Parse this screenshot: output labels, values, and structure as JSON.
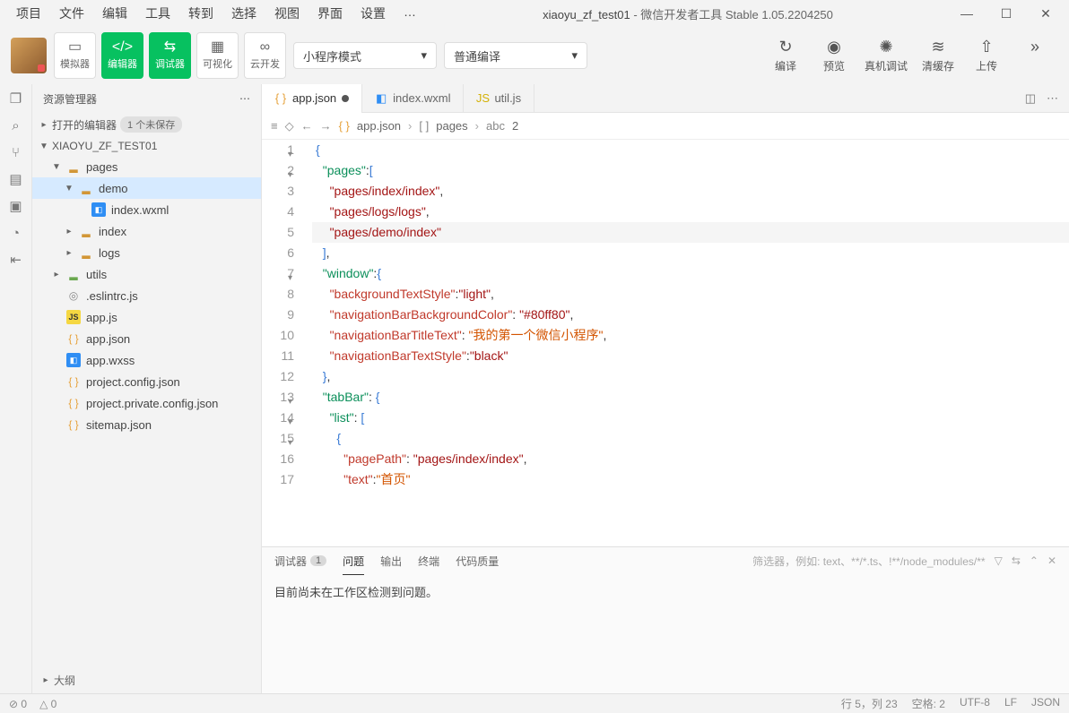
{
  "menu": {
    "items": [
      "项目",
      "文件",
      "编辑",
      "工具",
      "转到",
      "选择",
      "视图",
      "界面",
      "设置",
      "…"
    ]
  },
  "window": {
    "project": "xiaoyu_zf_test01",
    "suffix": " - 微信开发者工具 Stable 1.05.2204250"
  },
  "toolbar": {
    "simulator": "模拟器",
    "editor": "编辑器",
    "debugger": "调试器",
    "visual": "可视化",
    "cloud": "云开发",
    "modeSelect": "小程序模式",
    "compileSelect": "普通编译",
    "compile": "编译",
    "preview": "预览",
    "remote": "真机调试",
    "clear": "清缓存",
    "upload": "上传"
  },
  "sidebar": {
    "title": "资源管理器",
    "open_editors": "打开的编辑器",
    "unsaved_badge": "1 个未保存",
    "project": "XIAOYU_ZF_TEST01",
    "tree": [
      {
        "ind": 1,
        "chev": "▼",
        "icon": "folder-o",
        "label": "pages"
      },
      {
        "ind": 2,
        "chev": "▼",
        "icon": "folder-o",
        "label": "demo",
        "sel": true
      },
      {
        "ind": 3,
        "chev": "",
        "icon": "wxml",
        "label": "index.wxml"
      },
      {
        "ind": 2,
        "chev": "▸",
        "icon": "folder",
        "label": "index"
      },
      {
        "ind": 2,
        "chev": "▸",
        "icon": "folder",
        "label": "logs"
      },
      {
        "ind": 1,
        "chev": "▸",
        "icon": "folder-g",
        "label": "utils"
      },
      {
        "ind": 1,
        "chev": "",
        "icon": "cfg",
        "label": ".eslintrc.js"
      },
      {
        "ind": 1,
        "chev": "",
        "icon": "js",
        "label": "app.js"
      },
      {
        "ind": 1,
        "chev": "",
        "icon": "json",
        "label": "app.json"
      },
      {
        "ind": 1,
        "chev": "",
        "icon": "wxss",
        "label": "app.wxss"
      },
      {
        "ind": 1,
        "chev": "",
        "icon": "json",
        "label": "project.config.json"
      },
      {
        "ind": 1,
        "chev": "",
        "icon": "json",
        "label": "project.private.config.json"
      },
      {
        "ind": 1,
        "chev": "",
        "icon": "json",
        "label": "sitemap.json"
      }
    ],
    "outline": "大纲"
  },
  "tabs": [
    {
      "icon": "json",
      "label": "app.json",
      "active": true,
      "dirty": true
    },
    {
      "icon": "wxml",
      "label": "index.wxml"
    },
    {
      "icon": "js",
      "label": "util.js"
    }
  ],
  "breadcrumb": {
    "file": "app.json",
    "seg1": "pages",
    "seg2": "2"
  },
  "code": {
    "lines": [
      {
        "n": 1,
        "fold": "▾",
        "html": "<span class='tk-br'>{</span>"
      },
      {
        "n": 2,
        "fold": "▾",
        "html": "  <span class='tk-key'>\"pages\"</span>:<span class='tk-br'>[</span>"
      },
      {
        "n": 3,
        "html": "    <span class='tk-str'>\"pages/index/index\"</span>,"
      },
      {
        "n": 4,
        "html": "    <span class='tk-str'>\"pages/logs/logs\"</span>,"
      },
      {
        "n": 5,
        "cur": true,
        "html": "    <span class='tk-str'>\"pages/demo/index\"</span>"
      },
      {
        "n": 6,
        "html": "  <span class='tk-br'>]</span>,"
      },
      {
        "n": 7,
        "fold": "▾",
        "html": "  <span class='tk-key'>\"window\"</span>:<span class='tk-br'>{</span>"
      },
      {
        "n": 8,
        "html": "    <span class='tk-prop'>\"backgroundTextStyle\"</span>:<span class='tk-str'>\"light\"</span>,"
      },
      {
        "n": 9,
        "html": "    <span class='tk-prop'>\"navigationBarBackgroundColor\"</span>: <span class='tk-str'>\"#80ff80\"</span>,"
      },
      {
        "n": 10,
        "html": "    <span class='tk-prop'>\"navigationBarTitleText\"</span>: <span class='tk-cn'>\"我的第一个微信小程序\"</span>,"
      },
      {
        "n": 11,
        "html": "    <span class='tk-prop'>\"navigationBarTextStyle\"</span>:<span class='tk-str'>\"black\"</span>"
      },
      {
        "n": 12,
        "html": "  <span class='tk-br'>}</span>,"
      },
      {
        "n": 13,
        "fold": "▾",
        "html": "  <span class='tk-key'>\"tabBar\"</span>: <span class='tk-br'>{</span>"
      },
      {
        "n": 14,
        "fold": "▾",
        "html": "    <span class='tk-key'>\"list\"</span>: <span class='tk-br'>[</span>"
      },
      {
        "n": 15,
        "fold": "▾",
        "html": "      <span class='tk-br'>{</span>"
      },
      {
        "n": 16,
        "html": "        <span class='tk-prop'>\"pagePath\"</span>: <span class='tk-str'>\"pages/index/index\"</span>,"
      },
      {
        "n": 17,
        "html": "        <span class='tk-prop'>\"text\"</span>:<span class='tk-cn'>\"首页\"</span>"
      }
    ]
  },
  "panel": {
    "tabs": {
      "debugger": "调试器",
      "debugger_count": "1",
      "problems": "问题",
      "output": "输出",
      "terminal": "终端",
      "quality": "代码质量"
    },
    "filter_placeholder": "筛选器，例如: text、**/*.ts、!**/node_modules/**",
    "message": "目前尚未在工作区检测到问题。"
  },
  "status": {
    "errors": "0",
    "warnings": "0",
    "pos": "行 5，列 23",
    "spaces": "空格: 2",
    "enc": "UTF-8",
    "eol": "LF",
    "lang": "JSON"
  }
}
